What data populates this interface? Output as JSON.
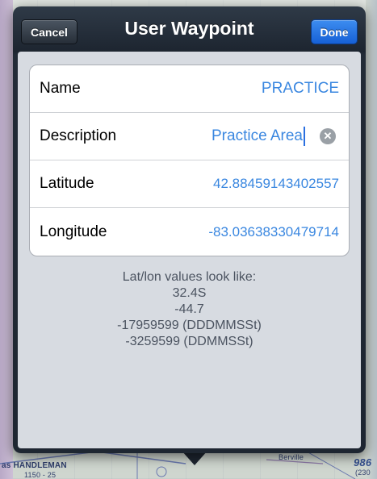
{
  "window": {
    "title": "User Waypoint",
    "cancel_label": "Cancel",
    "done_label": "Done"
  },
  "fields": [
    {
      "label": "Name",
      "value": "PRACTICE"
    },
    {
      "label": "Description",
      "value": "Practice Area",
      "editing": true
    },
    {
      "label": "Latitude",
      "value": "42.88459143402557"
    },
    {
      "label": "Longitude",
      "value": "-83.03638330479714"
    }
  ],
  "help_text": {
    "heading": "Lat/lon values look like:",
    "examples": [
      "32.4S",
      "-44.7",
      "-17959599 (DDDMMSSt)",
      "-3259599 (DDMMSSt)"
    ]
  },
  "map_labels": {
    "bottom_left": "HANDLEMAN",
    "bottom_left_prefix": "as",
    "bottom_left_freq": "1150 - 25",
    "bottom_right_town": "Berville",
    "bottom_right_num": "986",
    "bottom_right_sub": "(230"
  },
  "colors": {
    "accent_blue": "#3a87e0",
    "done_button": "#1f6fe0",
    "popover_dark": "#1e2631"
  },
  "icons": {
    "clear": "clear-circle-x-icon"
  }
}
